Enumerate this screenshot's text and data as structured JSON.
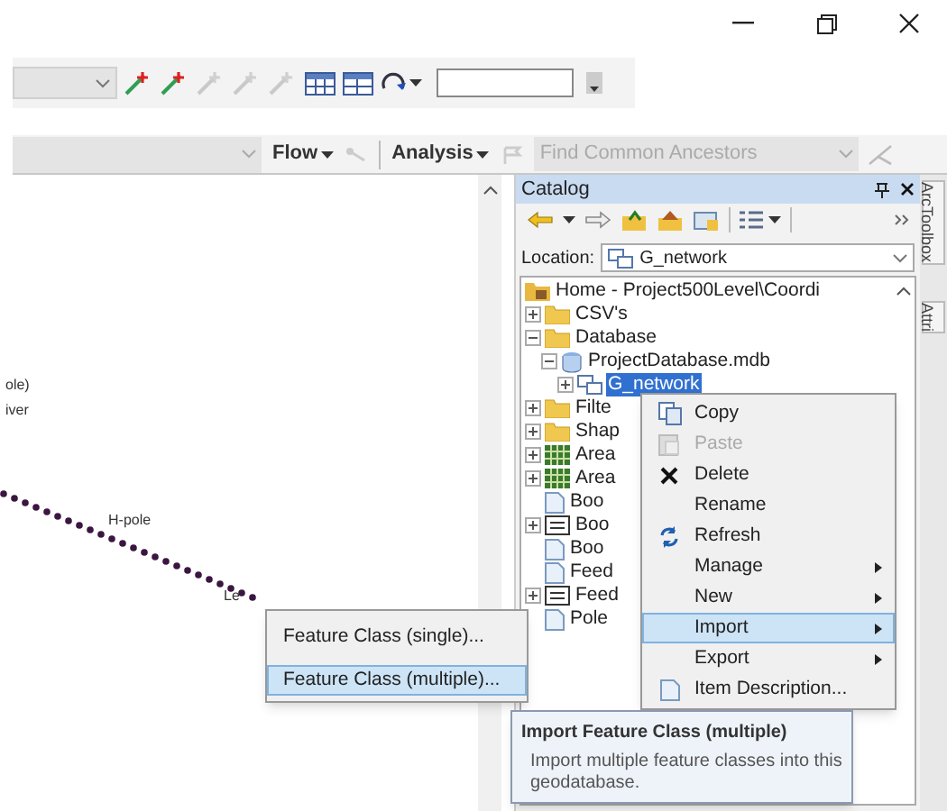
{
  "toolbar_2": {
    "menus": [
      {
        "label": "Flow"
      },
      {
        "label": "Analysis"
      }
    ],
    "trace_task": {
      "value": "Find Common Ancestors",
      "disabled": true
    }
  },
  "map": {
    "labels": [
      {
        "text": "ole)"
      },
      {
        "text": "iver"
      },
      {
        "text": "H-pole"
      },
      {
        "text": "Le"
      }
    ]
  },
  "catalog": {
    "title": "Catalog",
    "location_label": "Location:",
    "location_value": "G_network",
    "tree": [
      {
        "label": "Home - Project500Level\\Coordi",
        "kind": "home",
        "selected": false,
        "children": [
          {
            "label": "CSV's",
            "kind": "folder",
            "expanded": false,
            "selected": false
          },
          {
            "label": "Database",
            "kind": "folder",
            "expanded": true,
            "selected": false,
            "children": [
              {
                "label": "ProjectDatabase.mdb",
                "kind": "database",
                "expanded": true,
                "selected": false,
                "children": [
                  {
                    "label": "G_network",
                    "kind": "dataset",
                    "expanded": false,
                    "selected": true
                  }
                ]
              }
            ]
          },
          {
            "label": "Filte",
            "kind": "folder",
            "expanded": false,
            "selected": false
          },
          {
            "label": "Shap",
            "kind": "folder",
            "expanded": false,
            "selected": false
          },
          {
            "label": "Area",
            "kind": "raster",
            "expanded": false,
            "selected": false
          },
          {
            "label": "Area",
            "kind": "raster",
            "expanded": false,
            "selected": false
          },
          {
            "label": "Boo",
            "kind": "document",
            "selected": false
          },
          {
            "label": "Boo",
            "kind": "table",
            "expanded": false,
            "selected": false
          },
          {
            "label": "Boo",
            "kind": "document",
            "selected": false
          },
          {
            "label": "Feed",
            "kind": "document",
            "selected": false
          },
          {
            "label": "Feed",
            "kind": "table",
            "expanded": false,
            "selected": false
          },
          {
            "label": "Pole",
            "kind": "document",
            "selected": false
          }
        ]
      }
    ]
  },
  "context_menu": [
    {
      "label": "Copy",
      "disabled": false,
      "selected": false,
      "submenu": false
    },
    {
      "label": "Paste",
      "disabled": true,
      "selected": false,
      "submenu": false
    },
    {
      "label": "Delete",
      "disabled": false,
      "selected": false,
      "submenu": false
    },
    {
      "label": "Rename",
      "disabled": false,
      "selected": false,
      "submenu": false
    },
    {
      "label": "Refresh",
      "disabled": false,
      "selected": false,
      "submenu": false
    },
    {
      "label": "Manage",
      "disabled": false,
      "selected": false,
      "submenu": true
    },
    {
      "label": "New",
      "disabled": false,
      "selected": false,
      "submenu": true
    },
    {
      "label": "Import",
      "disabled": false,
      "selected": true,
      "submenu": true
    },
    {
      "label": "Export",
      "disabled": false,
      "selected": false,
      "submenu": true
    },
    {
      "label": "Item Description...",
      "disabled": false,
      "selected": false,
      "submenu": false
    }
  ],
  "import_submenu": [
    {
      "label": "Feature Class (single)...",
      "selected": false
    },
    {
      "label": "Feature Class (multiple)...",
      "selected": true
    }
  ],
  "tooltip": {
    "title": "Import Feature Class (multiple)",
    "body": "Import multiple feature classes into this geodatabase."
  },
  "side_tabs": [
    {
      "label": "ArcToolbox"
    },
    {
      "label": "Attri"
    }
  ]
}
